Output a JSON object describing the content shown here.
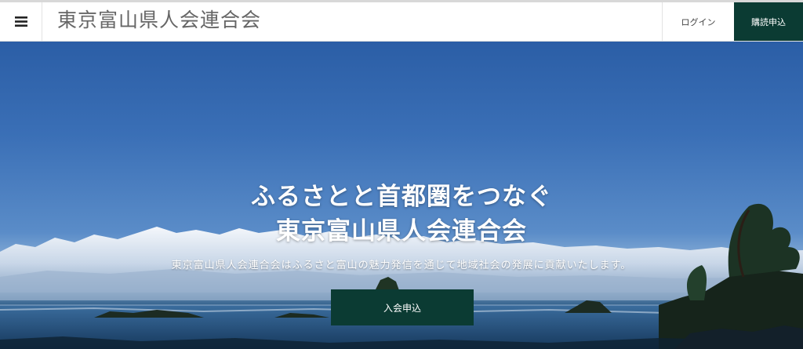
{
  "header": {
    "menu_icon": "hamburger-menu-icon",
    "site_title": "東京富山県人会連合会",
    "login_label": "ログイン",
    "subscribe_label": "購読申込",
    "subscribe_color": "#0b3b33"
  },
  "hero": {
    "title_line1": "ふるさとと首都圏をつなぐ",
    "title_line2": "東京富山県人会連合会",
    "description": "東京富山県人会連合会はふるさと富山の魅力発信を通じて地域社会の発展に貢献いたします。",
    "join_label": "入会申込",
    "join_color": "#0b3b33"
  }
}
